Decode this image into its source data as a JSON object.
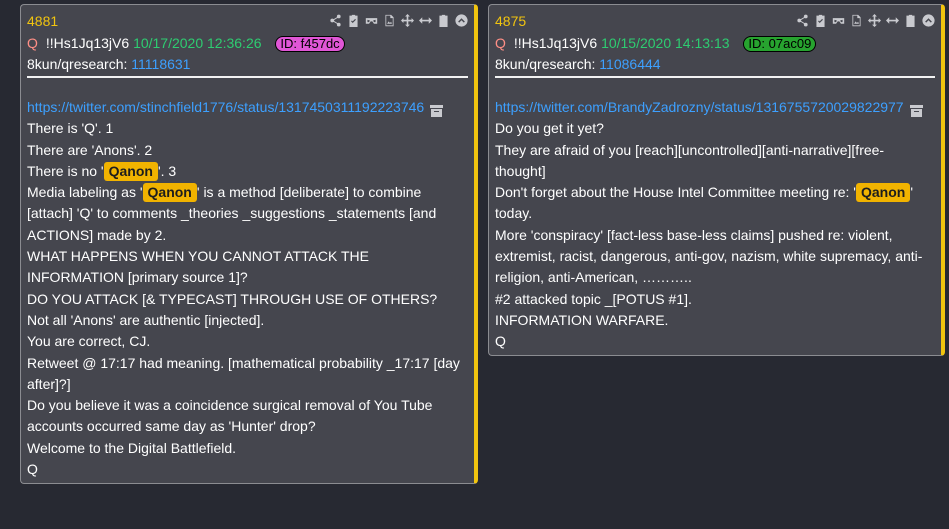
{
  "colors": {
    "accent": "#f1c40f",
    "trip_date": "#2ecc71",
    "link": "#3da0ff",
    "id_badge_1": "#e056d6",
    "id_badge_2": "#27a32f"
  },
  "toolbar_icons": [
    "share-icon",
    "clipboard-check-icon",
    "glasses-icon",
    "file-image-icon",
    "move-icon",
    "expand-horizontal-icon",
    "clipboard-icon",
    "collapse-icon"
  ],
  "posts": [
    {
      "number": "4881",
      "q": "Q",
      "trip": "!!Hs1Jq13jV6",
      "date": "10/17/2020 12:36:26",
      "id": "ID: f457dc",
      "board": "8kun/qresearch:",
      "ref": "11118631",
      "link": "https://twitter.com/stinchfield1776/status/1317450311192223746",
      "lines": [
        "There is 'Q'. 1",
        "There are 'Anons'. 2",
        "There is no '",
        "Qanon",
        "'. 3",
        "Media labeling as '",
        "Qanon",
        "' is a method [deliberate] to combine [attach] 'Q' to comments _theories _suggestions _statements [and ACTIONS] made by 2.",
        "WHAT HAPPENS WHEN YOU CANNOT ATTACK THE INFORMATION [primary source 1]?",
        "DO YOU ATTACK [& TYPECAST] THROUGH USE OF OTHERS?",
        "Not all 'Anons' are authentic [injected].",
        "You are correct, CJ.",
        "Retweet @ 17:17 had meaning. [mathematical probability _17:17 [day after]?]",
        "Do you believe it was a coincidence surgical removal of You Tube accounts occurred same day as 'Hunter' drop?",
        "Welcome to the Digital Battlefield.",
        "Q"
      ]
    },
    {
      "number": "4875",
      "q": "Q",
      "trip": "!!Hs1Jq13jV6",
      "date": "10/15/2020 14:13:13",
      "id": "ID: 07ac09",
      "board": "8kun/qresearch:",
      "ref": "11086444",
      "link": "https://twitter.com/BrandyZadrozny/status/1316755720029822977",
      "lines": [
        "Do you get it yet?",
        "They are afraid of you [reach][uncontrolled][anti-narrative][free-thought]",
        "Don't forget about the House Intel Committee meeting re: '",
        "Qanon",
        "' today.",
        "More 'conspiracy' [fact-less base-less claims] pushed re: violent, extremist, racist, dangerous, anti-gov, nazism, white supremacy, anti-religion, anti-American, ………..",
        "#2 attacked topic _[POTUS #1].",
        "INFORMATION WARFARE.",
        "Q"
      ]
    }
  ]
}
